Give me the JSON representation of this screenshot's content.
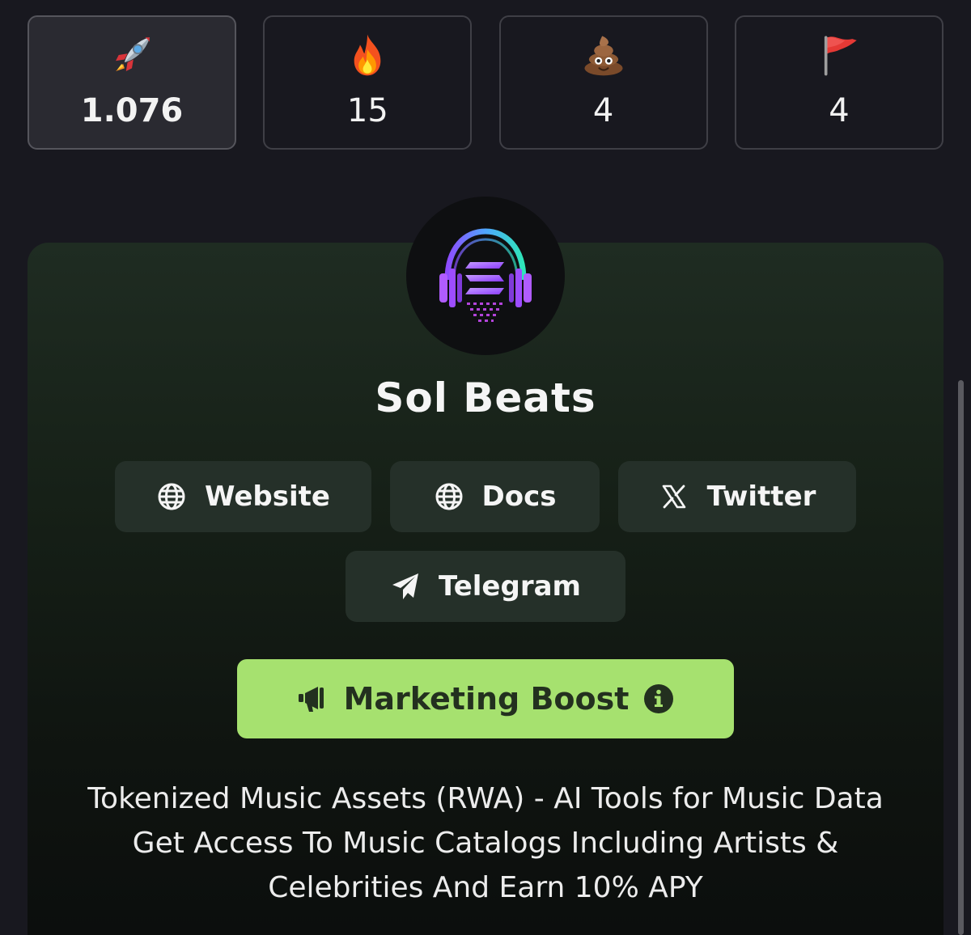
{
  "reactions": [
    {
      "icon": "rocket-icon",
      "count": "1.076",
      "selected": true
    },
    {
      "icon": "fire-icon",
      "count": "15",
      "selected": false
    },
    {
      "icon": "poop-icon",
      "count": "4",
      "selected": false
    },
    {
      "icon": "red-flag-icon",
      "count": "4",
      "selected": false
    }
  ],
  "project": {
    "name": "Sol Beats",
    "logo_icon": "headphones-solana-logo",
    "description": "Tokenized Music Assets (RWA) - AI Tools for Music Data Get Access To Music Catalogs Including Artists & Celebrities And Earn 10% APY"
  },
  "links": {
    "website": {
      "label": "Website",
      "icon": "globe-icon"
    },
    "docs": {
      "label": "Docs",
      "icon": "globe-icon"
    },
    "twitter": {
      "label": "Twitter",
      "icon": "x-logo-icon"
    },
    "telegram": {
      "label": "Telegram",
      "icon": "telegram-icon"
    }
  },
  "boost": {
    "label": "Marketing Boost",
    "icon": "megaphone-icon",
    "info_icon": "info-icon"
  },
  "colors": {
    "background": "#18181f",
    "card_top": "#1f2c22",
    "link_button": "#253029",
    "boost_button": "#a6e16f",
    "boost_text": "#23301f"
  }
}
